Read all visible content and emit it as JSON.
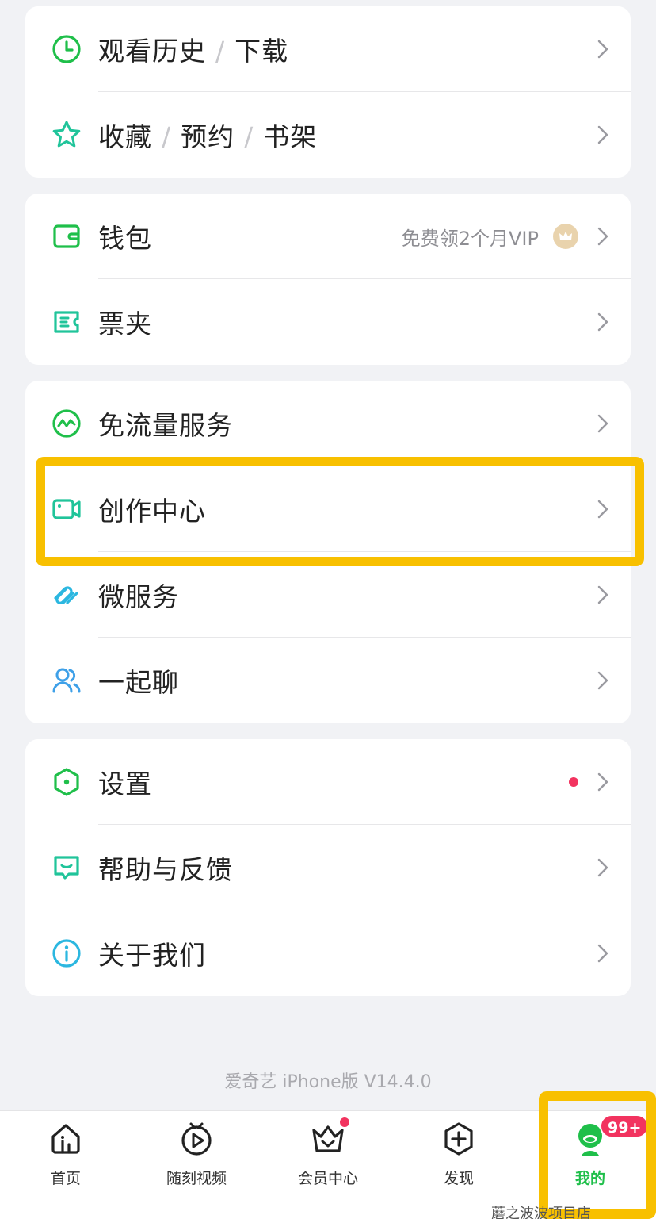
{
  "groups": [
    {
      "rows": [
        {
          "parts": [
            "观看历史",
            "下载"
          ],
          "sep": "/",
          "icon": "clock-icon"
        },
        {
          "parts": [
            "收藏",
            "预约",
            "书架"
          ],
          "sep": "/",
          "icon": "star-icon"
        }
      ]
    },
    {
      "rows": [
        {
          "label": "钱包",
          "hint": "免费领2个月VIP",
          "icon": "wallet-icon",
          "hint_icon": "crown-badge-icon"
        },
        {
          "label": "票夹",
          "icon": "ticket-icon"
        }
      ]
    },
    {
      "rows": [
        {
          "label": "免流量服务",
          "icon": "traffic-free-icon"
        },
        {
          "label": "创作中心",
          "icon": "video-camera-icon"
        },
        {
          "label": "微服务",
          "icon": "link-icon"
        },
        {
          "label": "一起聊",
          "icon": "people-icon"
        }
      ]
    },
    {
      "rows": [
        {
          "label": "设置",
          "icon": "hexagon-settings-icon",
          "has_red_dot": true
        },
        {
          "label": "帮助与反馈",
          "icon": "feedback-chat-icon"
        },
        {
          "label": "关于我们",
          "icon": "info-icon"
        }
      ]
    }
  ],
  "version": "爱奇艺 iPhone版 V14.4.0",
  "tabbar": {
    "tabs": [
      {
        "label": "首页",
        "icon": "home-icon"
      },
      {
        "label": "随刻视频",
        "icon": "play-circle-icon"
      },
      {
        "label": "会员中心",
        "icon": "crown-basket-icon",
        "has_dot": true
      },
      {
        "label": "发现",
        "icon": "plus-hexagon-icon"
      },
      {
        "label": "我的",
        "icon": "avatar-icon",
        "active": true
      }
    ],
    "badge": "99+"
  },
  "watermark": "蘑之波波项目店",
  "colors": {
    "accent_green": "#1fbf4a",
    "highlight_yellow": "#f8c000",
    "badge_red": "#f2335f",
    "background": "#f1f2f5"
  }
}
